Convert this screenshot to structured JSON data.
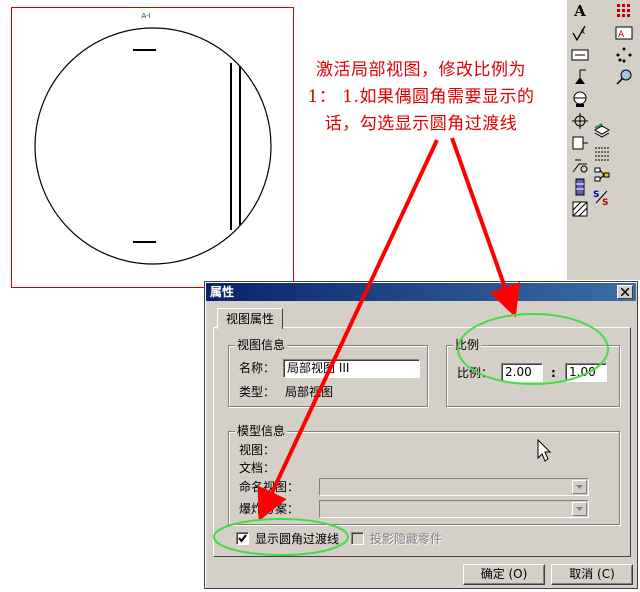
{
  "drawing": {
    "top_label": "一 A-I"
  },
  "annotation": {
    "lines": [
      "激活局部视图，修改比例为",
      "1： 1.如果偶圆角需要显示的",
      "话，勾选显示圆角过渡线"
    ],
    "color": "#e00000"
  },
  "toolbar": {
    "text_glyph": "A",
    "icons": [
      "text-icon",
      "surface-finish-icon",
      "weld-symbol-icon",
      "datum-feature-icon",
      "datum-target-icon",
      "centermark-icon",
      "hole-callout-icon",
      "balloon-icon",
      "stacked-balloon-icon",
      "area-hatch-icon",
      "hatch-icon",
      "cosmetic-thread-icon",
      "block-icon",
      "layer-icon",
      "auto-balloon-icon",
      "smart-dimension-icon",
      "magnetic-line-icon",
      "stretch-icon",
      "model-items-icon"
    ]
  },
  "dialog": {
    "title": "属性",
    "tab": "视图属性",
    "view_info": {
      "title": "视图信息",
      "name_label": "名称：",
      "name_value": "局部视图 III",
      "type_label": "类型：",
      "type_value": "局部视图"
    },
    "scale": {
      "title": "比例",
      "label": "比例：",
      "numerator": "2.00",
      "separator": ":",
      "denominator": "1.00"
    },
    "model_info": {
      "title": "模型信息",
      "view_label": "视图：",
      "doc_label": "文档：",
      "named_view_label": "命名视图：",
      "explode_label": "爆炸方案："
    },
    "show_tangent_edges": {
      "label": "显示圆角过渡线",
      "checked": true
    },
    "show_hidden_parts": {
      "label": "投影隐藏零件",
      "checked": false,
      "enabled": false
    },
    "ok_label": "确定 (O)",
    "cancel_label": "取消 (C)"
  },
  "colors": {
    "arrow": "#ff0000",
    "highlight": "#33cc33",
    "titlebar": "#0a246a"
  }
}
